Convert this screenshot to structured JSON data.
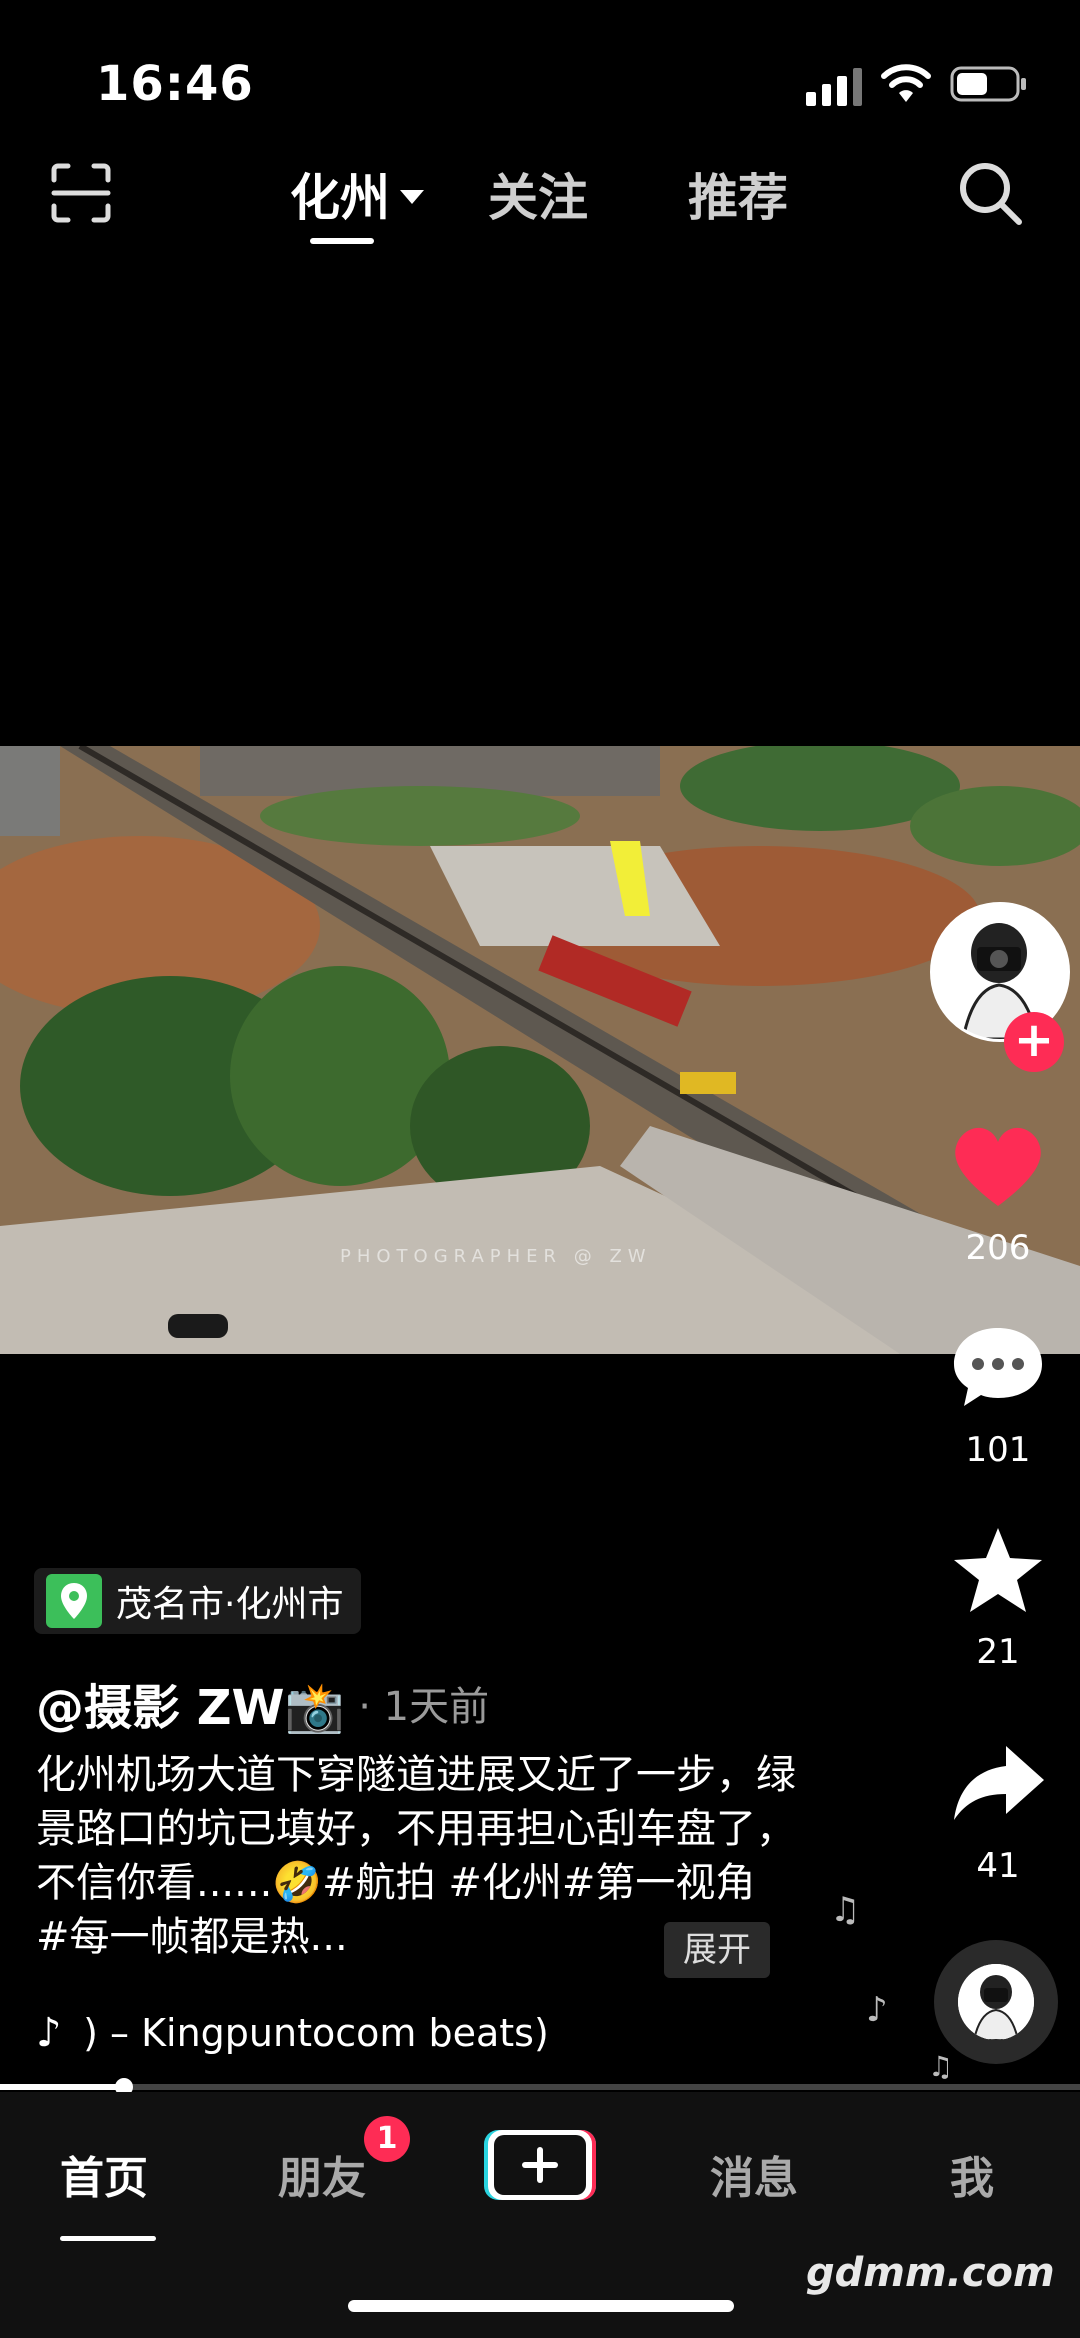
{
  "status_bar": {
    "time": "16:46"
  },
  "top_nav": {
    "tabs": [
      {
        "label": "化州",
        "active": true
      },
      {
        "label": "关注",
        "active": false
      },
      {
        "label": "推荐",
        "active": false
      }
    ]
  },
  "video": {
    "watermark": "PHOTOGRAPHER @ ZW",
    "progress": 0.115
  },
  "actions": {
    "likes": "206",
    "comments": "101",
    "favorites": "21",
    "shares": "41"
  },
  "post": {
    "location": "茂名市·化州市",
    "author": "@摄影 ZW📸",
    "time": "· 1天前",
    "caption": "化州机场大道下穿隧道进展又近了一步，绿景路口的坑已填好，不用再担心刮车盘了，不信你看......🤣#航拍 #化州#第一视角 #每一帧都是热...",
    "expand_label": "展开",
    "music": " ) – Kingpuntocom beats)"
  },
  "bottom_nav": {
    "items": [
      {
        "label": "首页",
        "active": true
      },
      {
        "label": "朋友",
        "badge": "1"
      },
      {
        "label": "消息"
      },
      {
        "label": "我"
      }
    ]
  },
  "site_watermark": "gdmm.com",
  "colors": {
    "accent": "#fe2c55",
    "location_green": "#3cbf5a"
  }
}
